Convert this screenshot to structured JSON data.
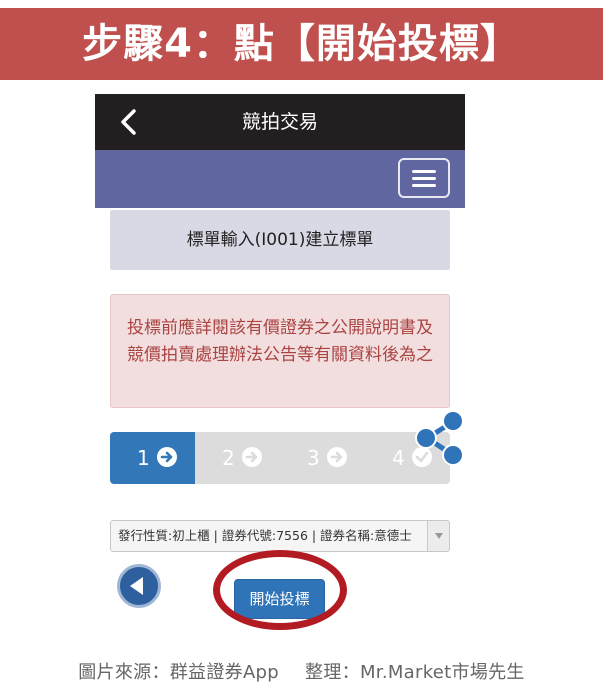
{
  "banner": {
    "title": "步驟4：點【開始投標】"
  },
  "app": {
    "header_title": "競拍交易",
    "form_title": "標單輸入(I001)建立標單",
    "notice": "投標前應詳閱該有價證券之公開說明書及競價拍賣處理辦法公告等有關資料後為之",
    "steps": [
      {
        "label": "1",
        "state": "active"
      },
      {
        "label": "2",
        "state": "inactive"
      },
      {
        "label": "3",
        "state": "inactive"
      },
      {
        "label": "4",
        "state": "inactive"
      }
    ],
    "security_select": "發行性質:初上櫃 | 證券代號:7556 | 證券名稱:意德士",
    "start_bid_button": "開始投標"
  },
  "caption": {
    "source": "圖片來源：群益證券App",
    "editor": "整理：Mr.Market市場先生"
  },
  "colors": {
    "banner": "#c0504d",
    "topbar": "#231f20",
    "navbar": "#6066a0",
    "active_step": "#3277b7",
    "highlight_circle": "#b31b22"
  }
}
